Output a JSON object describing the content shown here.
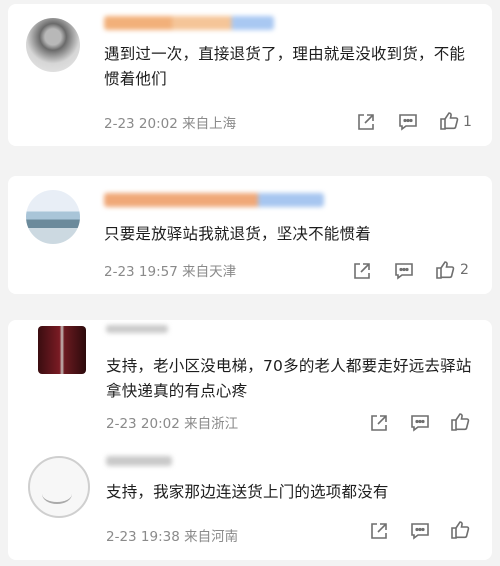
{
  "comments": [
    {
      "text": "遇到过一次，直接退货了，理由就是没收到货，不能惯着他们",
      "time": "2-23 20:02",
      "location": "来自上海",
      "likes": "1"
    },
    {
      "text": "只要是放驿站我就退货，坚决不能惯着",
      "time": "2-23 19:57",
      "location": "来自天津",
      "likes": "2"
    },
    {
      "text": "支持，老小区没电梯，70多的老人都要走好远去驿站拿快递真的有点心疼",
      "time": "2-23 20:02",
      "location": "来自浙江",
      "likes": ""
    },
    {
      "text": "支持，我家那边连送货上门的选项都没有",
      "time": "2-23 19:38",
      "location": "来自河南",
      "likes": ""
    }
  ],
  "icons": {
    "share": "share-icon",
    "comment": "comment-icon",
    "like": "thumbs-up-icon"
  }
}
